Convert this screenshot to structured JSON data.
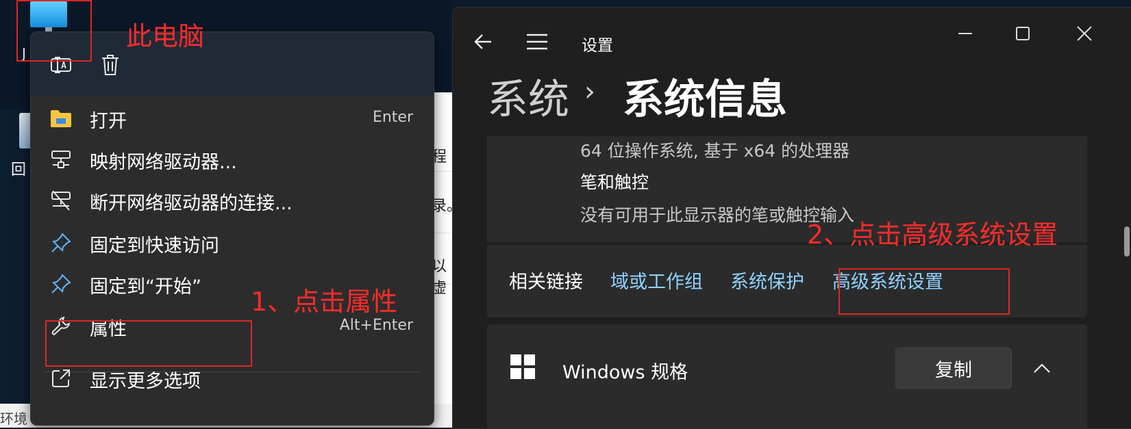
{
  "desktop": {
    "pc_label_fragment": "J",
    "recycle_label_fragment": "回",
    "bottom_text_fragment": "环境",
    "window_fragments": [
      "程",
      "录。",
      "以虚"
    ]
  },
  "annotations": {
    "this_pc": "此电脑",
    "step1": "1、点击属性",
    "step2": "2、点击高级系统设置"
  },
  "context_menu": {
    "top_icons": [
      "rename-icon",
      "delete-icon"
    ],
    "items": [
      {
        "icon": "folder-icon",
        "label": "打开",
        "shortcut": "Enter"
      },
      {
        "icon": "map-network-drive-icon",
        "label": "映射网络驱动器...",
        "shortcut": ""
      },
      {
        "icon": "disconnect-network-drive-icon",
        "label": "断开网络驱动器的连接...",
        "shortcut": ""
      },
      {
        "icon": "pin-icon",
        "label": "固定到快速访问",
        "shortcut": ""
      },
      {
        "icon": "pin-icon",
        "label": "固定到“开始”",
        "shortcut": ""
      },
      {
        "icon": "wrench-icon",
        "label": "属性",
        "shortcut": "Alt+Enter"
      },
      {
        "icon": "show-more-icon",
        "label": "显示更多选项",
        "shortcut": ""
      }
    ]
  },
  "settings": {
    "title": "设置",
    "breadcrumb": {
      "parent": "系统",
      "separator": "›",
      "current": "系统信息"
    },
    "system_type_value": "64 位操作系统, 基于 x64 的处理器",
    "pen_touch_heading": "笔和触控",
    "pen_touch_value": "没有可用于此显示器的笔或触控输入",
    "related_links": {
      "label": "相关链接",
      "links": [
        "域或工作组",
        "系统保护",
        "高级系统设置"
      ]
    },
    "windows_spec": {
      "label": "Windows 规格",
      "copy_button": "复制"
    },
    "colors": {
      "link": "#8fd2ff",
      "annotation": "#ff2b2b"
    }
  }
}
